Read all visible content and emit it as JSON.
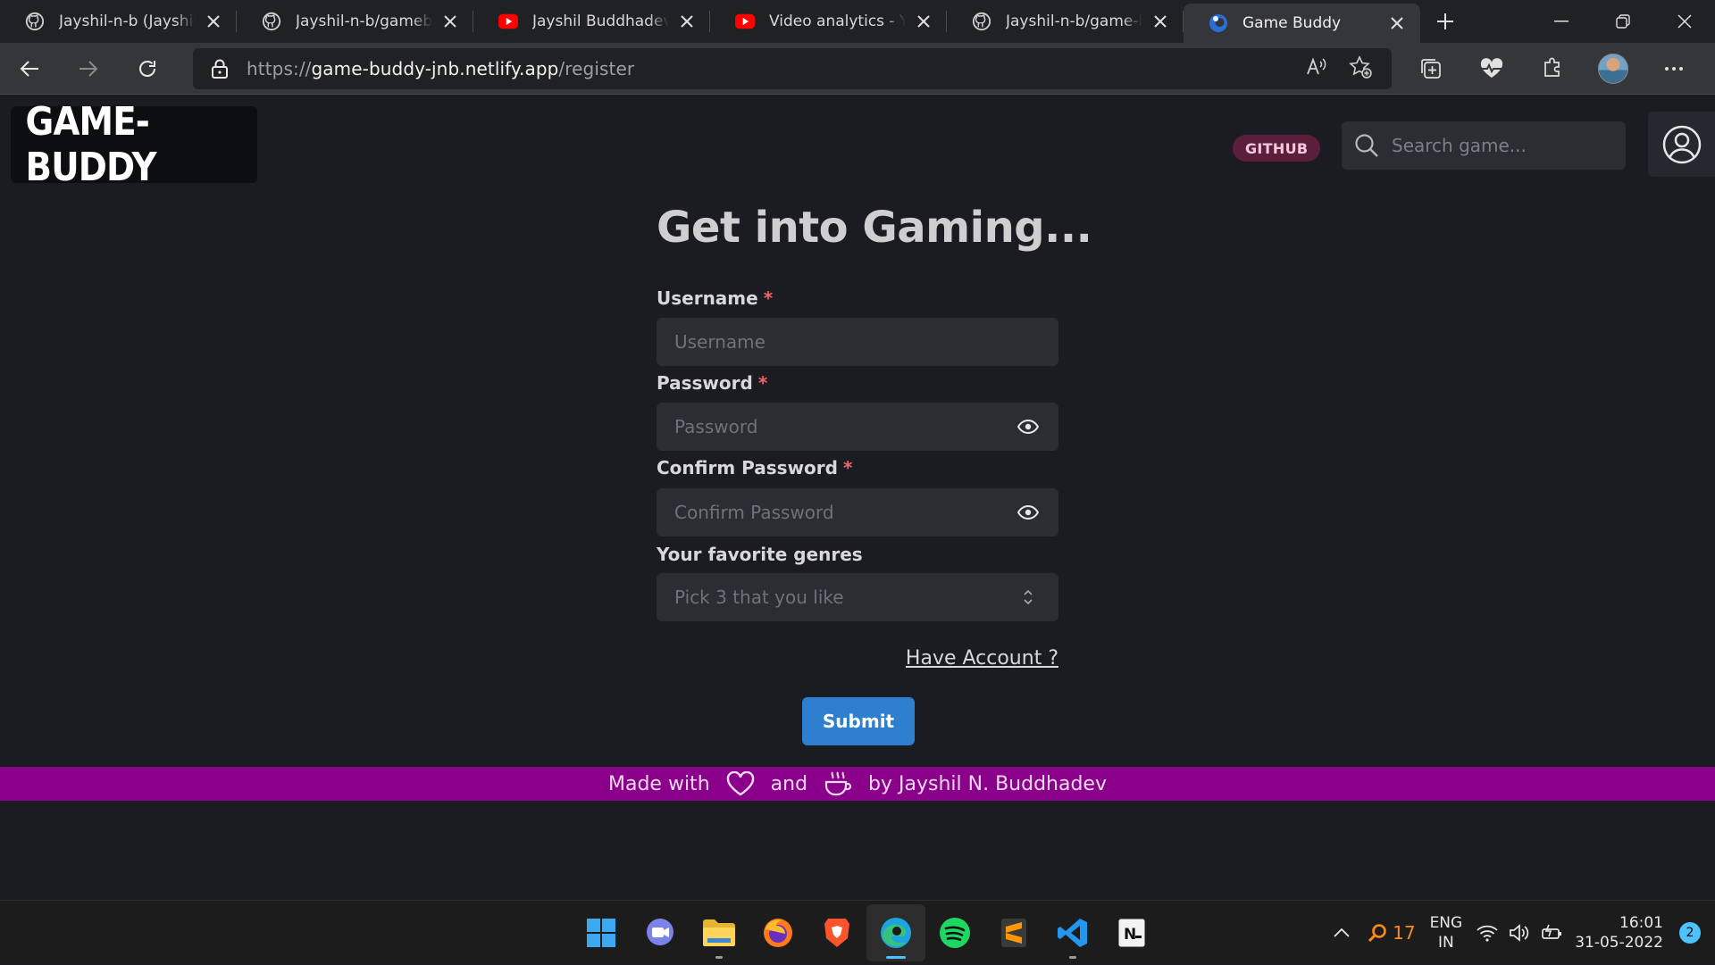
{
  "browser": {
    "tabs": [
      {
        "title": "Jayshil-n-b (Jayshil N",
        "icon": "github-icon"
      },
      {
        "title": "Jayshil-n-b/gamebuddy",
        "icon": "github-icon"
      },
      {
        "title": "Jayshil Buddhadev - YouTube",
        "icon": "youtube-icon"
      },
      {
        "title": "Video analytics - YouTube",
        "icon": "youtube-icon"
      },
      {
        "title": "Jayshil-n-b/game-buddy",
        "icon": "github-icon"
      },
      {
        "title": "Game Buddy",
        "icon": "edge-favicon",
        "active": true
      }
    ],
    "url_scheme": "https://",
    "url_host": "game-buddy-jnb.netlify.app",
    "url_path": "/register"
  },
  "header": {
    "logo": "GAME-BUDDY",
    "github_badge": "GITHUB",
    "search_placeholder": "Search game..."
  },
  "form": {
    "heading": "Get into Gaming...",
    "required_mark": "*",
    "username_label": "Username",
    "username_placeholder": "Username",
    "password_label": "Password",
    "password_placeholder": "Password",
    "confirm_label": "Confirm Password",
    "confirm_placeholder": "Confirm Password",
    "genres_label": "Your favorite genres",
    "genres_placeholder": "Pick 3 that you like",
    "have_account": "Have Account ?",
    "submit": "Submit"
  },
  "footer": {
    "made_with": "Made with",
    "and": "and",
    "by": "by Jayshil N. Buddhadev"
  },
  "taskbar": {
    "apps": [
      "start",
      "teams-chat",
      "file-explorer",
      "firefox",
      "brave",
      "edge",
      "spotify",
      "sublime-text",
      "vscode",
      "notion"
    ],
    "tray_count": "17",
    "lang_line1": "ENG",
    "lang_line2": "IN",
    "time": "16:01",
    "date": "31-05-2022",
    "notifications": "2"
  },
  "colors": {
    "page_bg": "#1a1c22",
    "accent_button": "#2f7fd1",
    "footer_bg": "#8a008a",
    "github_badge_bg": "#5c1f3b",
    "required": "#f56565"
  }
}
